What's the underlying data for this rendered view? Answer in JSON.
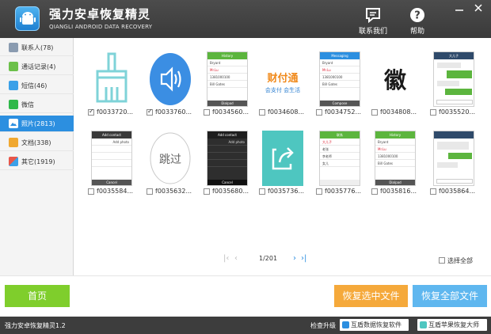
{
  "app": {
    "title": "强力安卓恢复精灵",
    "subtitle": "QIANGLI ANDROID DATA RECOVERY",
    "contact_label": "联系我们",
    "help_label": "帮助"
  },
  "sidebar": {
    "items": [
      {
        "label": "联系人(78)",
        "icon": "contacts-icon",
        "color": "#8a9bb0"
      },
      {
        "label": "通话记录(4)",
        "icon": "call-log-icon",
        "color": "#6cc04a"
      },
      {
        "label": "短信(46)",
        "icon": "sms-icon",
        "color": "#3aa0e8"
      },
      {
        "label": "微信",
        "icon": "wechat-icon",
        "color": "#2fb84a"
      },
      {
        "label": "照片(2813)",
        "icon": "photo-icon",
        "color": "#ffffff"
      },
      {
        "label": "文档(338)",
        "icon": "document-icon",
        "color": "#f0a830"
      },
      {
        "label": "其它(1919)",
        "icon": "other-icon",
        "color": "#e8574a"
      }
    ]
  },
  "photos": [
    {
      "name": "f0033720...",
      "checked": true,
      "kind": "broom"
    },
    {
      "name": "f0033760...",
      "checked": true,
      "kind": "speaker"
    },
    {
      "name": "f0034560...",
      "checked": false,
      "kind": "history"
    },
    {
      "name": "f0034608...",
      "checked": false,
      "kind": "caifutong"
    },
    {
      "name": "f0034752...",
      "checked": false,
      "kind": "messaging"
    },
    {
      "name": "f0034808...",
      "checked": false,
      "kind": "calligraphy"
    },
    {
      "name": "f0035520...",
      "checked": false,
      "kind": "chat"
    },
    {
      "name": "f0035584...",
      "checked": false,
      "kind": "add-contact"
    },
    {
      "name": "f0035632...",
      "checked": false,
      "kind": "skip"
    },
    {
      "name": "f0035680...",
      "checked": false,
      "kind": "add-contact-dark"
    },
    {
      "name": "f0035736...",
      "checked": false,
      "kind": "share"
    },
    {
      "name": "f0035776...",
      "checked": false,
      "kind": "contacts-list"
    },
    {
      "name": "f0035816...",
      "checked": false,
      "kind": "history2"
    },
    {
      "name": "f0035864...",
      "checked": false,
      "kind": "chat2"
    }
  ],
  "phone_text": {
    "history": "History",
    "messaging": "Messaging",
    "dialpad": "Dialpad",
    "compose": "Compose",
    "add_contact": "Add contact",
    "add_photo": "Add photo",
    "cancel": "Cancel",
    "done": "Done",
    "names": [
      "Bryant",
      "Mr.Lu",
      "1381000100",
      "Bill Gates"
    ],
    "cn_names": [
      "大儿子",
      "老张",
      "李老师",
      "女儿"
    ],
    "contacts_title": "联系",
    "chat_title": "大儿子",
    "skip": "跳过",
    "caifu_main": "财付通",
    "caifu_sub": "会支付 会生活",
    "callig": "徽"
  },
  "pager": {
    "page": "1/201",
    "select_all": "选择全部"
  },
  "actions": {
    "home": "首页",
    "recover_selected": "恢复选中文件",
    "recover_all": "恢复全部文件"
  },
  "status": {
    "version": "强力安卓恢复精灵1.2",
    "update": "检查升级",
    "link1": "互盾数据恢复软件",
    "link2": "互盾苹果恢复大师"
  },
  "colors": {
    "accent": "#2c8fe0",
    "home": "#7fce2c",
    "recover_selected": "#f5a93b",
    "recover_all": "#5fb7ef"
  }
}
